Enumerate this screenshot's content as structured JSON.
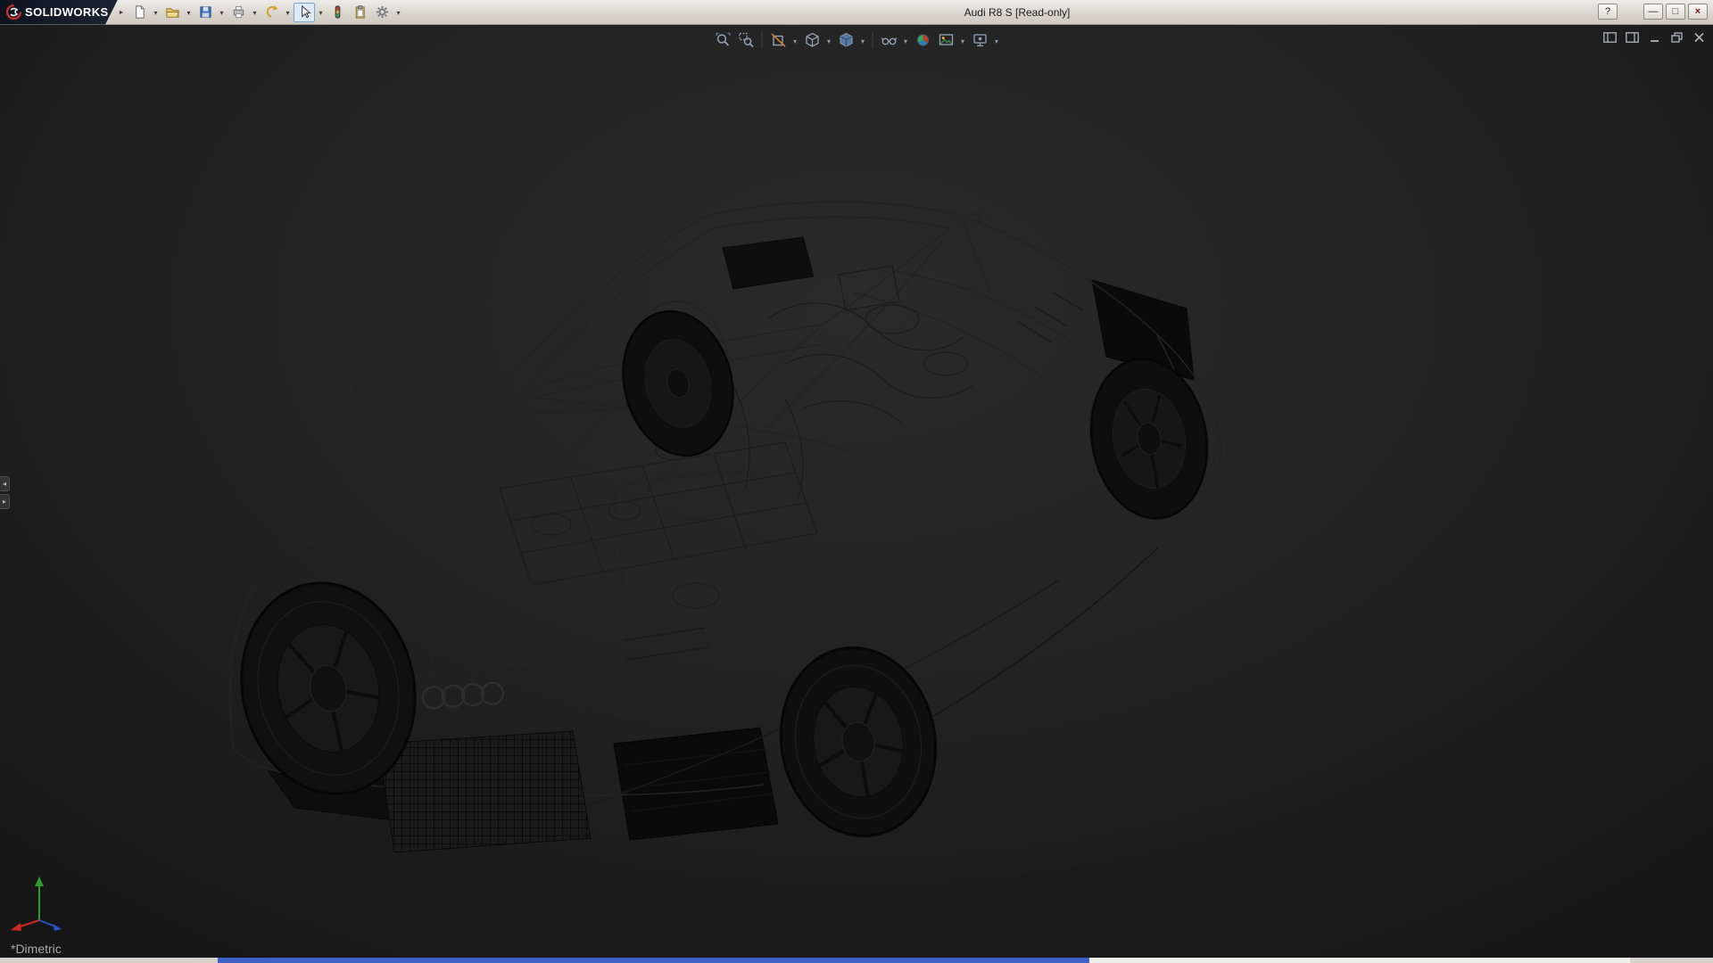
{
  "window": {
    "title": "Audi R8 S [Read-only]",
    "brand": "SOLIDWORKS",
    "controls": {
      "help": "?",
      "minimize": "—",
      "maximize": "□",
      "close": "×"
    }
  },
  "glyphs": {
    "dropdown": "▾",
    "toolbar_expand": "▸",
    "splitter_left": "◂",
    "splitter_right": "▸"
  },
  "main_toolbar": {
    "items": [
      {
        "name": "new-document",
        "has_dropdown": true
      },
      {
        "name": "open",
        "has_dropdown": true
      },
      {
        "name": "save",
        "has_dropdown": true
      },
      {
        "name": "print",
        "has_dropdown": true
      },
      {
        "name": "undo",
        "has_dropdown": true
      },
      {
        "name": "select",
        "has_dropdown": true,
        "pressed": true
      },
      {
        "name": "rebuild",
        "has_dropdown": false
      },
      {
        "name": "paste",
        "has_dropdown": false
      },
      {
        "name": "options",
        "has_dropdown": true
      }
    ]
  },
  "heads_up_toolbar": {
    "items": [
      {
        "name": "zoom-to-fit",
        "has_dropdown": false
      },
      {
        "name": "zoom-to-area",
        "has_dropdown": false
      },
      {
        "name": "section-view",
        "has_dropdown": true
      },
      {
        "name": "view-orientation",
        "has_dropdown": true
      },
      {
        "name": "display-style",
        "has_dropdown": true
      },
      {
        "name": "hide-show-items",
        "has_dropdown": true
      },
      {
        "name": "edit-appearance",
        "has_dropdown": false
      },
      {
        "name": "apply-scene",
        "has_dropdown": true
      },
      {
        "name": "view-settings",
        "has_dropdown": true
      }
    ]
  },
  "viewport": {
    "view_orientation_label": "*Dimetric",
    "model": "Audi R8 S wireframe",
    "background_center": "#2a2a2a",
    "background_edge": "#161616"
  },
  "triad_colors": {
    "x": "#cc2a22",
    "y": "#2f9e2f",
    "z": "#2a52c8"
  },
  "statusbar": {
    "segments": [
      {
        "color": "#d6d2c9"
      },
      {
        "color": "#3f62c9"
      },
      {
        "color": "#efeeea"
      },
      {
        "color": "#d6d2c9"
      }
    ]
  }
}
